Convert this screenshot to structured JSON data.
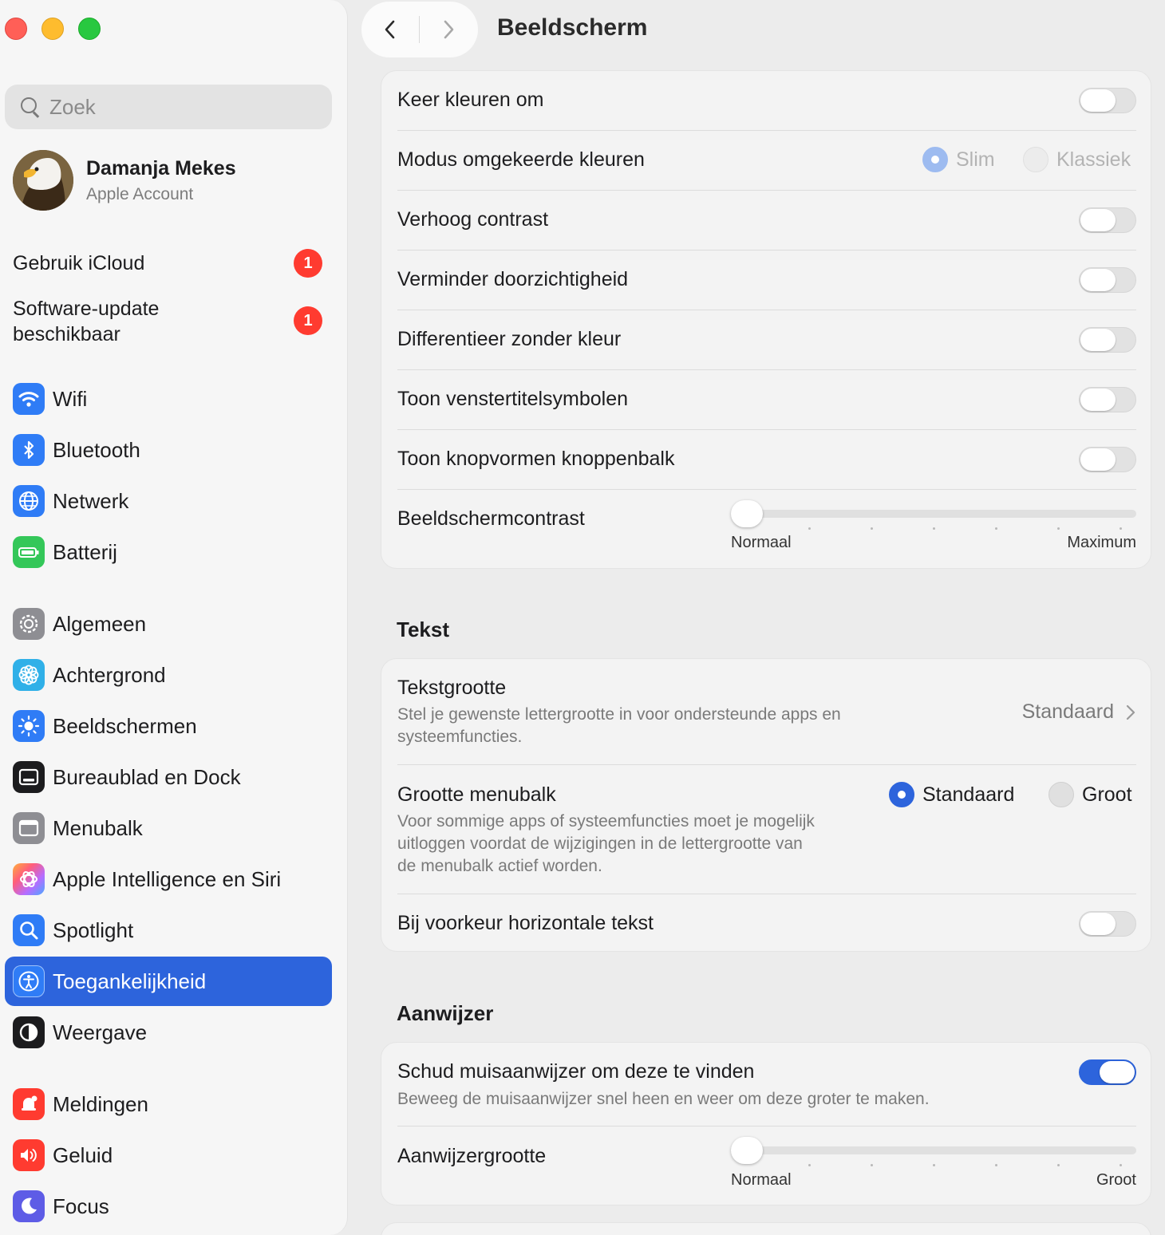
{
  "sidebar": {
    "search_placeholder": "Zoek",
    "account": {
      "name": "Damanja Mekes",
      "subtitle": "Apple Account"
    },
    "notices": [
      {
        "label": "Gebruik iCloud",
        "badge": "1"
      },
      {
        "label_line1": "Software-update",
        "label_line2": "beschikbaar",
        "badge": "1"
      }
    ],
    "items": [
      {
        "label": "Wifi",
        "icon": "wifi-icon",
        "color": "#2f7cf6"
      },
      {
        "label": "Bluetooth",
        "icon": "bluetooth-icon",
        "color": "#2f7cf6"
      },
      {
        "label": "Netwerk",
        "icon": "globe-icon",
        "color": "#2f7cf6"
      },
      {
        "label": "Batterij",
        "icon": "battery-icon",
        "color": "#34c759"
      },
      {
        "label": "Algemeen",
        "icon": "gear-icon",
        "color": "#8e8e93"
      },
      {
        "label": "Achtergrond",
        "icon": "flower-icon",
        "color": "#30b0e8"
      },
      {
        "label": "Beeldschermen",
        "icon": "sun-icon",
        "color": "#2f7cf6"
      },
      {
        "label": "Bureaublad en Dock",
        "icon": "dock-icon",
        "color": "#1c1c1e"
      },
      {
        "label": "Menubalk",
        "icon": "menubar-icon",
        "color": "#8e8e93"
      },
      {
        "label": "Apple Intelligence en Siri",
        "icon": "siri-icon",
        "color": "#ff7a59"
      },
      {
        "label": "Spotlight",
        "icon": "magnifier-icon",
        "color": "#2f7cf6"
      },
      {
        "label": "Toegankelijkheid",
        "icon": "accessibility-icon",
        "color": "#2f7cf6",
        "selected": true
      },
      {
        "label": "Weergave",
        "icon": "appearance-icon",
        "color": "#1c1c1e"
      },
      {
        "label": "Meldingen",
        "icon": "bell-icon",
        "color": "#ff3b30"
      },
      {
        "label": "Geluid",
        "icon": "speaker-icon",
        "color": "#ff3b30"
      },
      {
        "label": "Focus",
        "icon": "moon-icon",
        "color": "#5e5ce6"
      }
    ]
  },
  "header": {
    "title": "Beeldscherm"
  },
  "display_group": {
    "invert_colors": {
      "label": "Keer kleuren om",
      "on": false
    },
    "invert_mode": {
      "label": "Modus omgekeerde kleuren",
      "options": [
        "Slim",
        "Klassiek"
      ],
      "selected": "Slim",
      "disabled": true
    },
    "increase_contrast": {
      "label": "Verhoog contrast",
      "on": false
    },
    "reduce_transparency": {
      "label": "Verminder doorzichtigheid",
      "on": false
    },
    "differentiate": {
      "label": "Differentieer zonder kleur",
      "on": false
    },
    "title_icons": {
      "label": "Toon venstertitelsymbolen",
      "on": false
    },
    "button_shapes": {
      "label": "Toon knopvormen knoppenbalk",
      "on": false
    },
    "display_contrast": {
      "label": "Beeldschermcontrast",
      "min_label": "Normaal",
      "max_label": "Maximum",
      "value": 0
    }
  },
  "text_section": {
    "title": "Tekst",
    "text_size": {
      "label": "Tekstgrootte",
      "desc_line1": "Stel je gewenste lettergrootte in voor ondersteunde apps en",
      "desc_line2": "systeemfuncties.",
      "value": "Standaard"
    },
    "menubar_size": {
      "label": "Grootte menubalk",
      "desc_line1": "Voor sommige apps of systeemfuncties moet je mogelijk",
      "desc_line2": "uitloggen voordat de wijzigingen in de lettergrootte van",
      "desc_line3": "de menubalk actief worden.",
      "options": [
        "Standaard",
        "Groot"
      ],
      "selected": "Standaard"
    },
    "horizontal_text": {
      "label": "Bij voorkeur horizontale tekst",
      "on": false
    }
  },
  "pointer_section": {
    "title": "Aanwijzer",
    "shake": {
      "label": "Schud muisaanwijzer om deze te vinden",
      "desc": "Beweeg de muisaanwijzer snel heen en weer om deze groter te maken.",
      "on": true
    },
    "pointer_size": {
      "label": "Aanwijzergrootte",
      "min_label": "Normaal",
      "max_label": "Groot",
      "value": 0
    }
  }
}
